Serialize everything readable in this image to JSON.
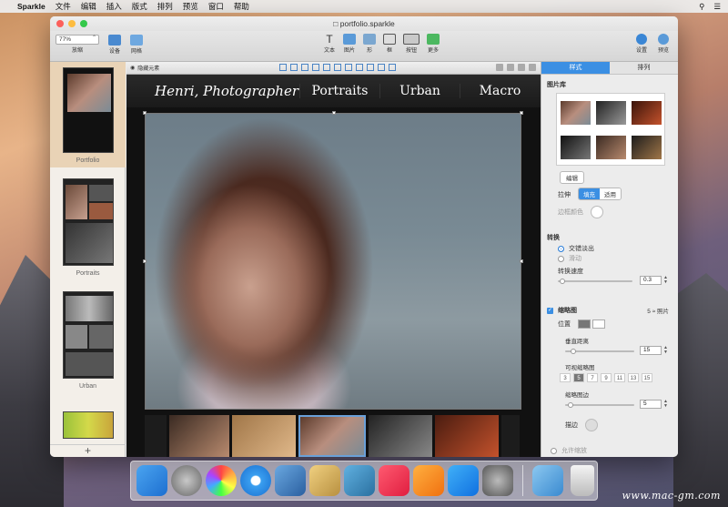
{
  "menubar": {
    "apple": "",
    "app_name": "Sparkle",
    "items": [
      "文件",
      "编辑",
      "插入",
      "版式",
      "排列",
      "预览",
      "窗口",
      "帮助"
    ]
  },
  "window": {
    "title": "portfolio.sparkle"
  },
  "toolbar": {
    "zoom_value": "77%",
    "zoom_label": "放缩",
    "device_label": "设备",
    "grid_label": "网格",
    "center_tools": [
      "文本",
      "图片",
      "形",
      "框",
      "按钮",
      "更多"
    ],
    "settings_label": "设置",
    "preview_label": "预览"
  },
  "pages": [
    {
      "label": "Portfolio"
    },
    {
      "label": "Portraits"
    },
    {
      "label": "Urban"
    },
    {
      "label": ""
    }
  ],
  "add_page": "+",
  "canvas": {
    "hide_label": "隐藏元素",
    "site_brand": "Henri, Photographer",
    "nav": [
      "Portraits",
      "Urban",
      "Macro"
    ]
  },
  "inspector": {
    "tabs": [
      "样式",
      "排列"
    ],
    "gallery_title": "图片库",
    "edit_button": "编辑",
    "stretch_label": "拉伸",
    "stretch_options": [
      "填充",
      "适用"
    ],
    "border_color_label": "边框颜色",
    "transition_title": "转换",
    "transition_options": [
      "交错淡出",
      "滑动"
    ],
    "transition_speed_label": "转换速度",
    "transition_speed_value": "0.3",
    "thumbnails_label": "缩略图",
    "thumbnails_count": "5 ≈ 照片",
    "position_label": "位置",
    "spacing_label": "垂直距离",
    "spacing_value": "15",
    "visible_label": "可视缩略图",
    "visible_options": [
      "3",
      "5",
      "7",
      "9",
      "11",
      "13",
      "15"
    ],
    "thumb_margin_label": "缩略图边",
    "thumb_margin_value": "5",
    "border_label": "描边",
    "bottom_label": "允许缩放"
  },
  "watermark": "www.mac-gm.com",
  "colors": {
    "accent": "#3b8fe3",
    "close": "#fc605b",
    "minimize": "#fdbc40",
    "maximize": "#34c84a"
  }
}
